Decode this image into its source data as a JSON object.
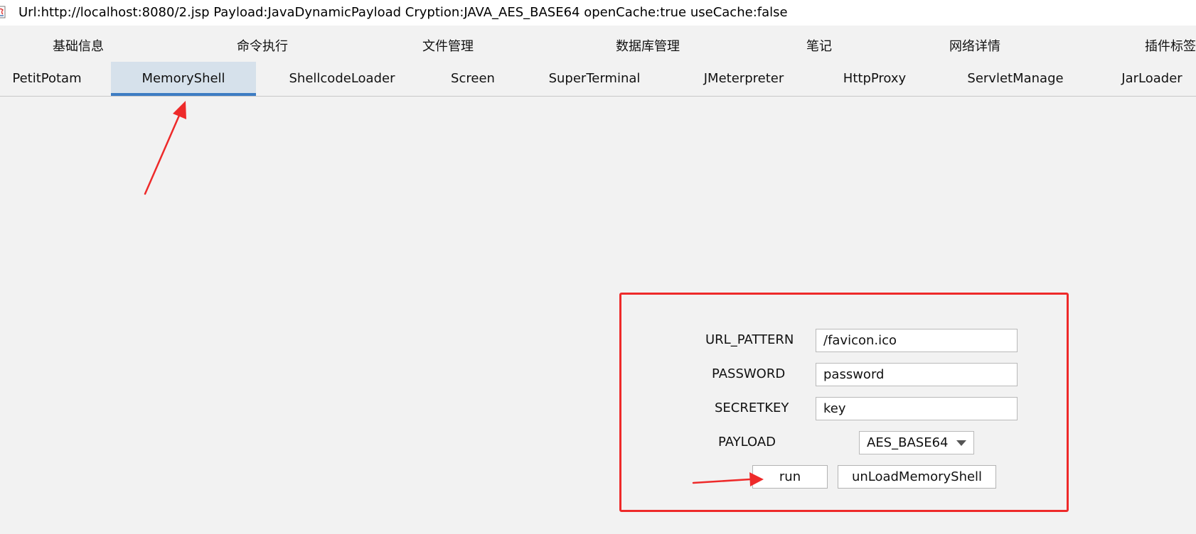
{
  "window": {
    "title": "Url:http://localhost:8080/2.jsp Payload:JavaDynamicPayload Cryption:JAVA_AES_BASE64 openCache:true useCache:false"
  },
  "tabs_row1": [
    {
      "label": "基础信息"
    },
    {
      "label": "命令执行"
    },
    {
      "label": "文件管理"
    },
    {
      "label": "数据库管理"
    },
    {
      "label": "笔记"
    },
    {
      "label": "网络详情"
    },
    {
      "label": "插件标签"
    }
  ],
  "tabs_row2": [
    {
      "label": "PetitPotam",
      "selected": false
    },
    {
      "label": "MemoryShell",
      "selected": true
    },
    {
      "label": "ShellcodeLoader",
      "selected": false
    },
    {
      "label": "Screen",
      "selected": false
    },
    {
      "label": "SuperTerminal",
      "selected": false
    },
    {
      "label": "JMeterpreter",
      "selected": false
    },
    {
      "label": "HttpProxy",
      "selected": false
    },
    {
      "label": "ServletManage",
      "selected": false
    },
    {
      "label": "JarLoader",
      "selected": false
    }
  ],
  "form": {
    "url_pattern": {
      "label": "URL_PATTERN",
      "value": "/favicon.ico"
    },
    "password": {
      "label": "PASSWORD",
      "value": "password"
    },
    "secretkey": {
      "label": "SECRETKEY",
      "value": "key"
    },
    "payload": {
      "label": "PAYLOAD",
      "value": "AES_BASE64"
    },
    "run_label": "run",
    "unload_label": "unLoadMemoryShell"
  },
  "annotations": {
    "highlight_color": "#ee2a2a",
    "selected_tab_color": "#3d7cc3"
  }
}
